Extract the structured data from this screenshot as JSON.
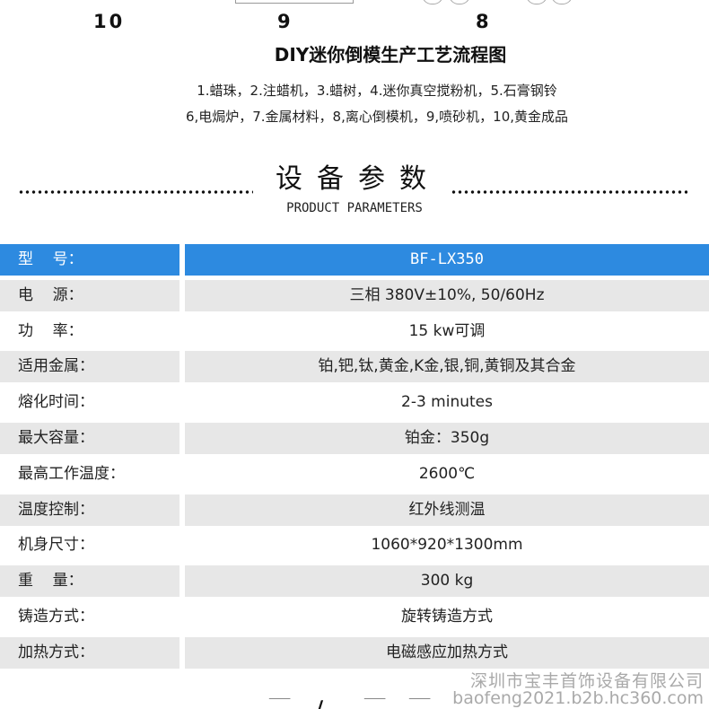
{
  "process": {
    "step_numbers": [
      "10",
      "9",
      "8"
    ],
    "title": "DIY迷你倒模生产工艺流程图",
    "legend_line1": "1.蜡珠，2.注蜡机，3.蜡树，4.迷你真空搅粉机，5.石膏钢铃",
    "legend_line2": "6,电焗炉，7.金属材料，8,离心倒模机，9,喷砂机，10,黄金成品"
  },
  "section": {
    "title": "设备参数",
    "subtitle": "PRODUCT PARAMETERS"
  },
  "specs": [
    {
      "label": "型    号：",
      "value": "BF-LX350"
    },
    {
      "label": "电    源：",
      "value": "三相 380V±10%, 50/60Hz"
    },
    {
      "label": "功    率：",
      "value": "15 kw可调"
    },
    {
      "label": "适用金属：",
      "value": "铂,钯,钛,黄金,K金,银,铜,黄铜及其合金"
    },
    {
      "label": "熔化时间：",
      "value": "2-3 minutes"
    },
    {
      "label": "最大容量：",
      "value": "铂金：350g"
    },
    {
      "label": "最高工作温度：",
      "value": "2600℃"
    },
    {
      "label": "温度控制：",
      "value": "红外线测温"
    },
    {
      "label": "机身尺寸：",
      "value": "1060*920*1300mm"
    },
    {
      "label": "重    量：",
      "value": "300 kg"
    },
    {
      "label": "铸造方式：",
      "value": "旋转铸造方式"
    },
    {
      "label": "加热方式：",
      "value": "电磁感应加热方式"
    }
  ],
  "watermark": {
    "company": "深圳市宝丰首饰设备有限公司",
    "site": "baofeng2021.b2b.hc360.com"
  },
  "colors": {
    "header_row": "#2d8ae0",
    "alt_row": "#e7e7e7",
    "text": "#222222"
  }
}
